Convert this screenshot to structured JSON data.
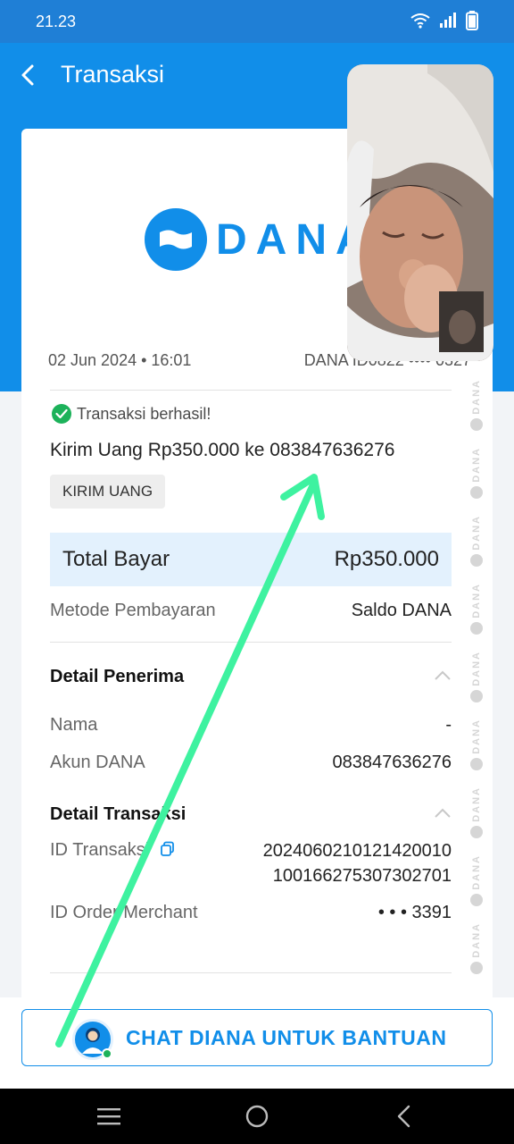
{
  "status_bar": {
    "time": "21.23"
  },
  "app_bar": {
    "title": "Transaksi"
  },
  "logo": {
    "text": "DANA"
  },
  "transaction": {
    "date_time": "02 Jun 2024 • 16:01",
    "dana_id": "DANA ID0822 •••• 0327",
    "status": "Transaksi berhasil!",
    "description": "Kirim Uang Rp350.000 ke 083847636276",
    "tag": "KIRIM UANG"
  },
  "payment": {
    "total_label": "Total Bayar",
    "total_value": "Rp350.000",
    "method_label": "Metode Pembayaran",
    "method_value": "Saldo DANA"
  },
  "recipient": {
    "section_title": "Detail Penerima",
    "name_label": "Nama",
    "name_value": "-",
    "account_label": "Akun DANA",
    "account_value": "083847636276"
  },
  "details": {
    "section_title": "Detail Transaksi",
    "id_label": "ID Transaksi",
    "id_value_line1": "2024060210121420010",
    "id_value_line2": "100166275307302701",
    "order_label": "ID Order Merchant",
    "order_value": "• • • 3391"
  },
  "watermark": {
    "text": "DANA"
  },
  "chat": {
    "label": "CHAT DIANA UNTUK BANTUAN"
  },
  "colors": {
    "brand": "#118ee9",
    "success": "#1cb25a",
    "arrow": "#3ef2a0"
  },
  "icons": [
    "back-arrow-icon",
    "wifi-icon",
    "signal-icon",
    "battery-icon",
    "check-icon",
    "copy-icon",
    "chevron-up-icon",
    "menu-icon",
    "home-icon",
    "back-nav-icon"
  ]
}
